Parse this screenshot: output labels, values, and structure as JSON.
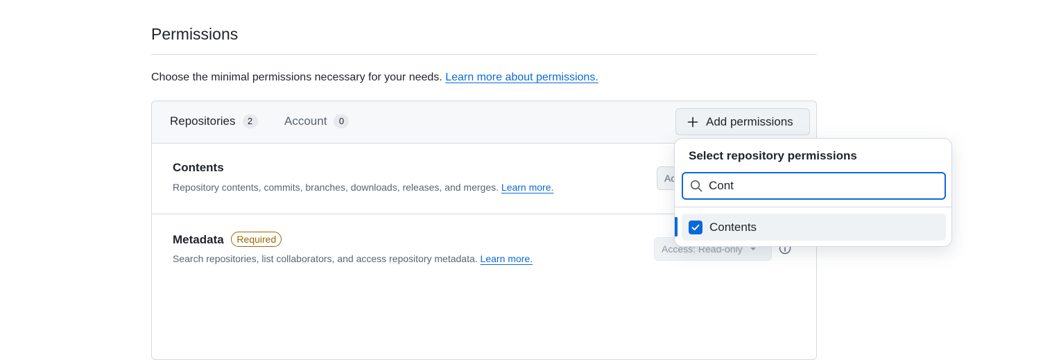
{
  "section": {
    "title": "Permissions",
    "intro_text": "Choose the minimal permissions necessary for your needs.",
    "intro_link": "Learn more about permissions."
  },
  "tabs": [
    {
      "label": "Repositories",
      "count": "2"
    },
    {
      "label": "Account",
      "count": "0"
    }
  ],
  "add_button": {
    "label": "Add permissions",
    "icon": "plus-icon"
  },
  "permissions": [
    {
      "name": "Contents",
      "description": "Repository contents, commits, branches, downloads, releases, and merges.",
      "link": "Learn more.",
      "access": "Ac"
    },
    {
      "name": "Metadata",
      "badge": "Required",
      "description": "Search repositories, list collaborators, and access repository metadata.",
      "link": "Learn more.",
      "access": "Access: Read-only"
    }
  ],
  "popover": {
    "title": "Select repository permissions",
    "search_value": "Cont",
    "items": [
      {
        "label": "Contents",
        "checked": true
      }
    ]
  },
  "colors": {
    "accent": "#0969da",
    "required": "#9a6700",
    "border": "#d1d9e0",
    "header_bg": "#f6f8fa"
  }
}
